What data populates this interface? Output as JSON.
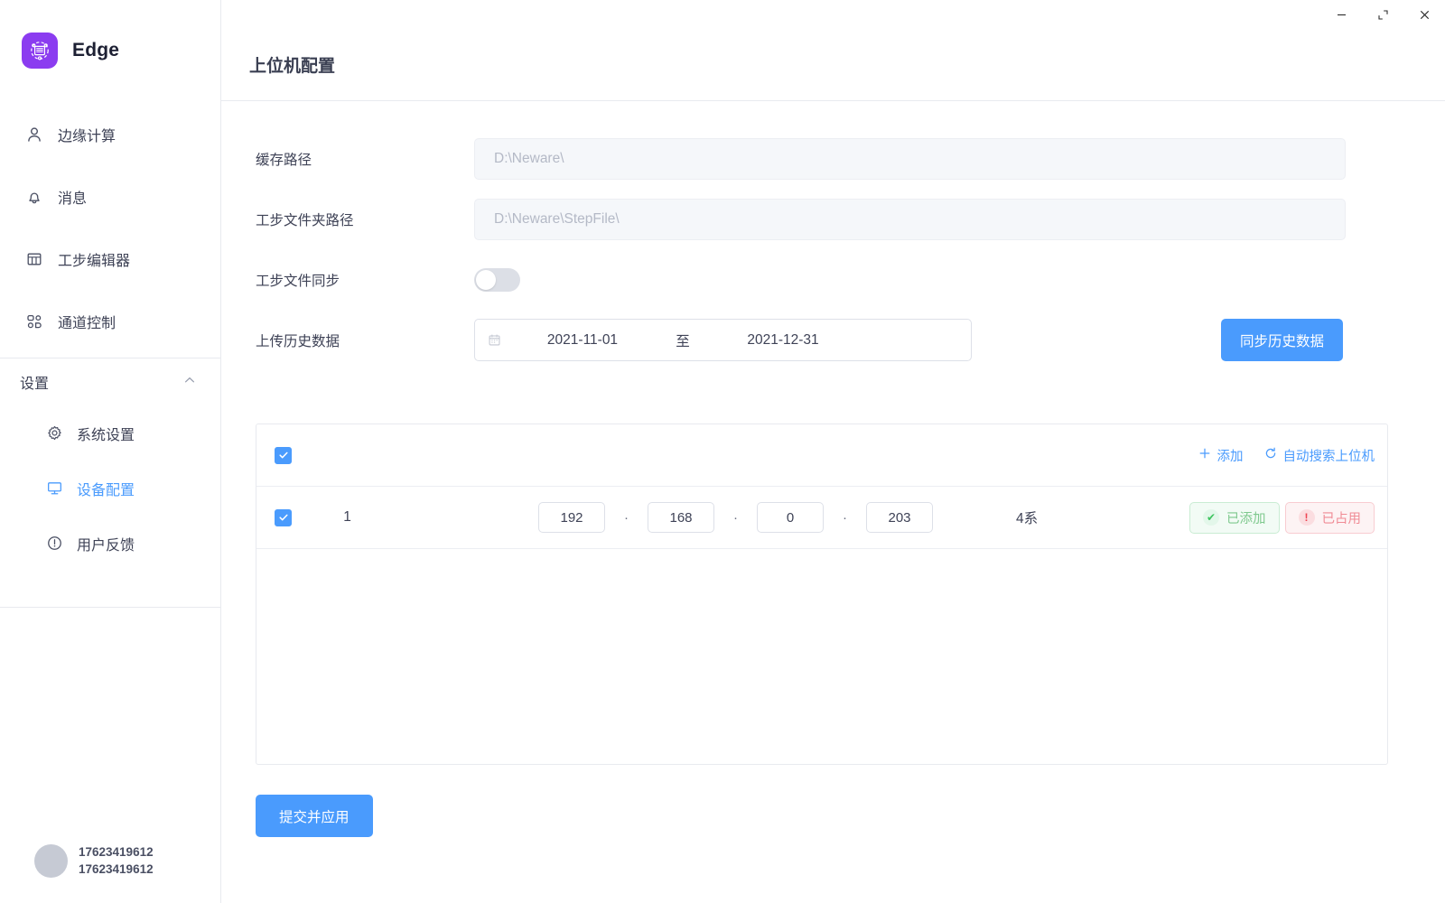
{
  "brand": {
    "name": "Edge",
    "logo_icon": "battery-scan-icon",
    "logo_color": "#8b3cf0"
  },
  "window": {
    "minimize": "─",
    "maximize": "⤡",
    "close": "✕"
  },
  "header": {
    "title": "上位机配置"
  },
  "sidebar": {
    "items": [
      {
        "label": "边缘计算",
        "icon": "user-icon"
      },
      {
        "label": "消息",
        "icon": "bell-icon"
      },
      {
        "label": "工步编辑器",
        "icon": "table-icon"
      },
      {
        "label": "通道控制",
        "icon": "channel-control-icon"
      }
    ],
    "group": {
      "label": "设置",
      "chevron_icon": "chevron-up-icon",
      "items": [
        {
          "label": "系统设置",
          "icon": "gear-icon",
          "active": false
        },
        {
          "label": "设备配置",
          "icon": "monitor-icon",
          "active": true
        },
        {
          "label": "用户反馈",
          "icon": "alert-circle-icon",
          "active": false
        }
      ]
    },
    "user": {
      "name_primary": "17623419612",
      "name_secondary": "17623419612",
      "avatar_icon": "avatar"
    }
  },
  "form": {
    "cache_path": {
      "label": "缓存路径",
      "placeholder": "D:\\Neware\\",
      "value": ""
    },
    "step_folder": {
      "label": "工步文件夹路径",
      "placeholder": "D:\\Neware\\StepFile\\",
      "value": ""
    },
    "step_sync": {
      "label": "工步文件同步",
      "enabled": false
    },
    "history": {
      "label": "上传历史数据",
      "calendar_icon": "calendar-icon",
      "start_date": "2021-11-01",
      "separator": "至",
      "end_date": "2021-12-31",
      "sync_button": "同步历史数据"
    }
  },
  "table": {
    "header": {
      "select_all_checked": true,
      "add_label": "添加",
      "add_icon": "plus-icon",
      "search_label": "自动搜索上位机",
      "search_icon": "refresh-icon"
    },
    "rows": [
      {
        "checked": true,
        "index": "1",
        "ip": [
          "192",
          "168",
          "0",
          "203"
        ],
        "dot": "·",
        "series": "4系",
        "badges": [
          {
            "text": "已添加",
            "type": "ok",
            "icon": "check-icon",
            "glyph": "✔"
          },
          {
            "text": "已占用",
            "type": "bad",
            "icon": "warning-icon",
            "glyph": "!"
          }
        ]
      }
    ]
  },
  "footer": {
    "submit_label": "提交并应用"
  },
  "colors": {
    "accent": "#4a9bfd",
    "brand": "#8b3cf0",
    "ok": "#7fc98e",
    "bad": "#f08b95"
  }
}
